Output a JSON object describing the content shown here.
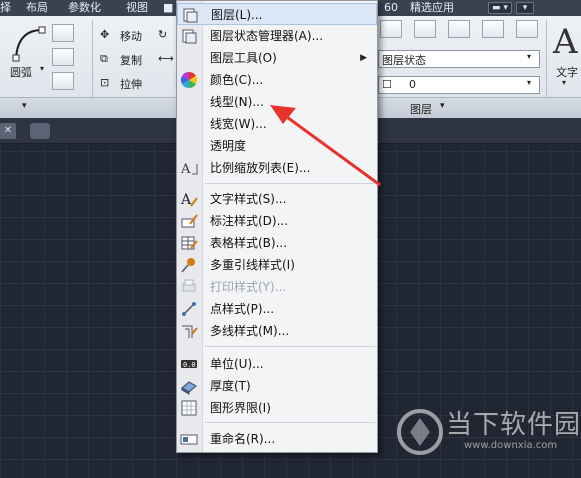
{
  "menubar": {
    "items": [
      "择",
      "布局",
      "参数化",
      "视图",
      "60",
      "精选应用"
    ]
  },
  "ribbon": {
    "draw": {
      "arc_label": "圆弧"
    },
    "modify": {
      "move_label": "移动",
      "copy_label": "复制",
      "stretch_label": "拉伸"
    },
    "layers": {
      "state_label": "图层状态",
      "current_layer": "0",
      "panel_title": "图层"
    },
    "annotation": {
      "text_label": "文字",
      "big_letter": "A"
    }
  },
  "dropdown": {
    "items": [
      {
        "label": "图层(L)...",
        "icon": "layer-properties-icon"
      },
      {
        "label": "图层状态管理器(A)...",
        "icon": "layer-state-manager-icon"
      },
      {
        "label": "图层工具(O)",
        "icon": "none",
        "submenu": true
      },
      {
        "label": "颜色(C)...",
        "icon": "color-wheel-icon"
      },
      {
        "label": "线型(N)...",
        "icon": "none"
      },
      {
        "label": "线宽(W)...",
        "icon": "none"
      },
      {
        "label": "透明度",
        "icon": "none"
      },
      {
        "label": "比例缩放列表(E)...",
        "icon": "scale-list-icon"
      },
      {
        "label": "文字样式(S)...",
        "icon": "text-style-icon"
      },
      {
        "label": "标注样式(D)...",
        "icon": "dimension-style-icon"
      },
      {
        "label": "表格样式(B)...",
        "icon": "table-style-icon"
      },
      {
        "label": "多重引线样式(I)",
        "icon": "multileader-style-icon"
      },
      {
        "label": "打印样式(Y)...",
        "icon": "plot-style-icon",
        "disabled": true
      },
      {
        "label": "点样式(P)...",
        "icon": "point-style-icon"
      },
      {
        "label": "多线样式(M)...",
        "icon": "multiline-style-icon"
      },
      {
        "label": "单位(U)...",
        "icon": "units-icon"
      },
      {
        "label": "厚度(T)",
        "icon": "thickness-icon"
      },
      {
        "label": "图形界限(I)",
        "icon": "drawing-limits-icon"
      },
      {
        "label": "重命名(R)...",
        "icon": "rename-icon"
      }
    ]
  },
  "watermark": {
    "cn": "当下软件园",
    "url": "www.downxia.com"
  },
  "colors": {
    "highlight": "#dbe7f6",
    "arrow": "#e8322c",
    "canvas": "#212633"
  }
}
